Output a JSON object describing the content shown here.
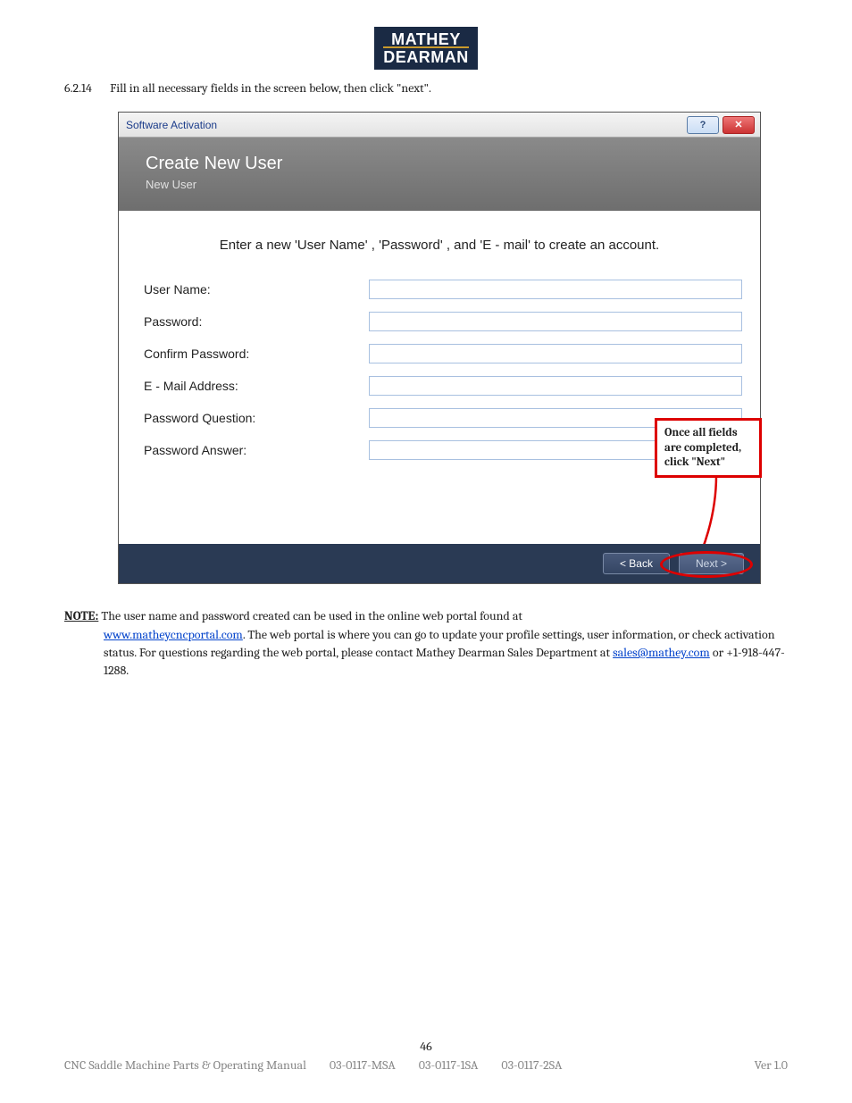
{
  "logo": {
    "line1": "MATHEY",
    "line2": "DEARMAN"
  },
  "step": {
    "number": "6.2.14",
    "text": "Fill in all necessary fields in the screen below, then click \"next\"."
  },
  "window": {
    "title": "Software Activation",
    "help_symbol": "?",
    "close_symbol": "✕",
    "header": "Create New User",
    "subheader": "New User",
    "instruction": "Enter a new 'User Name' , 'Password' , and 'E - mail' to create an account.",
    "fields": {
      "username": "User Name:",
      "password": "Password:",
      "confirm": "Confirm Password:",
      "email": "E - Mail Address:",
      "question": "Password Question:",
      "answer": "Password Answer:"
    },
    "buttons": {
      "back": "<  Back",
      "next": "Next  >"
    }
  },
  "callout": "Once all fields are completed, click \"Next\"",
  "note": {
    "label": "NOTE:",
    "t1": "The user name and password created can be used in the online web portal found at ",
    "link1": "www.matheycncportal.com",
    "t2": ".  The web portal is where you can go to update your profile settings, user information, or check activation status.  For questions regarding the web portal, please contact Mathey Dearman Sales Department at ",
    "link2": "sales@mathey.com",
    "t3": " or +1-918-447-1288."
  },
  "footer": {
    "page": "46",
    "manual": "CNC Saddle Machine Parts & Operating Manual",
    "c1": "03-0117-MSA",
    "c2": "03-0117-1SA",
    "c3": "03-0117-2SA",
    "ver": "Ver 1.0"
  }
}
